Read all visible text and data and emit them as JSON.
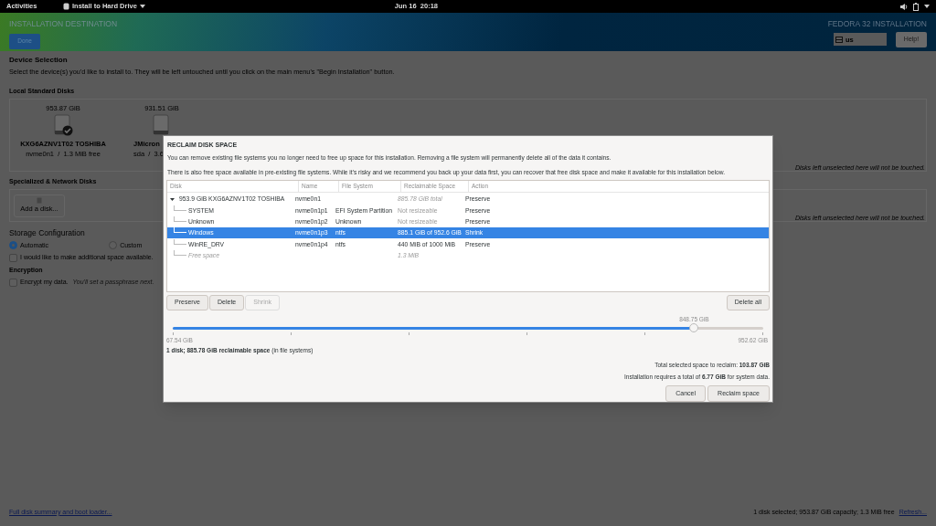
{
  "top_bar": {
    "activities": "Activities",
    "app_menu": "Install to Hard Drive",
    "clock": "Jun 16  20:18"
  },
  "header": {
    "title": "INSTALLATION DESTINATION",
    "done": "Done",
    "product": "FEDORA 32 INSTALLATION",
    "keyboard": "us",
    "help": "Help!"
  },
  "device_selection": {
    "heading": "Device Selection",
    "description": "Select the device(s) you'd like to install to.  They will be left untouched until you click on the main menu's \"Begin Installation\" button.",
    "local_label": "Local Standard Disks",
    "disks": [
      {
        "size": "953.87 GiB",
        "name": "KXG6AZNV1T02 TOSHIBA",
        "detail": "nvme0n1  /  1.3 MiB free",
        "selected": true
      },
      {
        "size": "931.51 GiB",
        "name": "JMicron",
        "detail": "sda  /  3.6",
        "selected": false
      }
    ],
    "local_note": "Disks left unselected here will not be touched.",
    "network_label": "Specialized & Network Disks",
    "add_disk": "Add a disk...",
    "network_note": "Disks left unselected here will not be touched."
  },
  "storage": {
    "heading": "Storage Configuration",
    "options": [
      {
        "label": "Automatic",
        "selected": true
      },
      {
        "label": "Custom",
        "selected": false
      }
    ],
    "extra_space": {
      "label": "I would like to make additional space available.",
      "checked": false
    },
    "encryption_heading": "Encryption",
    "encrypt": {
      "label": "Encrypt my data.",
      "hint": "You'll set a passphrase next.",
      "checked": false
    }
  },
  "footer": {
    "summary_link": "Full disk summary and boot loader...",
    "status": "1 disk selected; 953.87 GiB capacity; 1.3 MiB free",
    "refresh": "Refresh..."
  },
  "dialog": {
    "title": "RECLAIM DISK SPACE",
    "intro": "You can remove existing file systems you no longer need to free up space for this installation.  Removing a file system will permanently delete all of the data it contains.",
    "intro2": "There is also free space available in pre-existing file systems.  While it's risky and we recommend you back up your data first, you can recover that free disk space and make it available for this installation below.",
    "columns": [
      "Disk",
      "Name",
      "File System",
      "Reclaimable Space",
      "Action"
    ],
    "tree": [
      {
        "kind": "disk",
        "label": "953.9 GiB KXG6AZNV1T02 TOSHIBA",
        "name": "nvme0n1",
        "reclaimable": "885.78 GiB total",
        "action": "Preserve",
        "expanded": true,
        "selected": false,
        "children": [
          {
            "kind": "partition",
            "label": "SYSTEM",
            "name": "nvme0n1p1",
            "filesystem": "EFI System Partition",
            "reclaimable": "Not resizeable",
            "resizable": false,
            "action": "Preserve",
            "selected": false
          },
          {
            "kind": "partition",
            "label": "Unknown",
            "name": "nvme0n1p2",
            "filesystem": "Unknown",
            "reclaimable": "Not resizeable",
            "resizable": false,
            "action": "Preserve",
            "selected": false
          },
          {
            "kind": "partition",
            "label": "Windows",
            "name": "nvme0n1p3",
            "filesystem": "ntfs",
            "reclaimable": "885.1 GiB of 952.6 GiB",
            "resizable": true,
            "action": "Shrink",
            "selected": true
          },
          {
            "kind": "partition",
            "label": "WinRE_DRV",
            "name": "nvme0n1p4",
            "filesystem": "ntfs",
            "reclaimable": "440 MiB of 1000 MiB",
            "resizable": true,
            "action": "Preserve",
            "selected": false
          },
          {
            "kind": "free",
            "label": "Free space",
            "reclaimable": "1.3 MiB",
            "selected": false
          }
        ]
      }
    ],
    "actions": [
      {
        "label": "Preserve",
        "disabled": false
      },
      {
        "label": "Delete",
        "disabled": false
      },
      {
        "label": "Shrink",
        "disabled": true
      }
    ],
    "delete_all": "Delete all",
    "slider": {
      "level": 0.883,
      "reading": "848.75 GiB",
      "min": "67.54 GiB",
      "max": "952.62 GiB"
    },
    "summary": "**1 disk; 885.78 GiB reclaimable space** (in file systems)",
    "total": "Total selected space to reclaim: **103.87 GiB**",
    "requirement": "Installation requires a total of **6.77 GiB** for system data.",
    "buttons": [
      "Cancel",
      "Reclaim space"
    ]
  }
}
